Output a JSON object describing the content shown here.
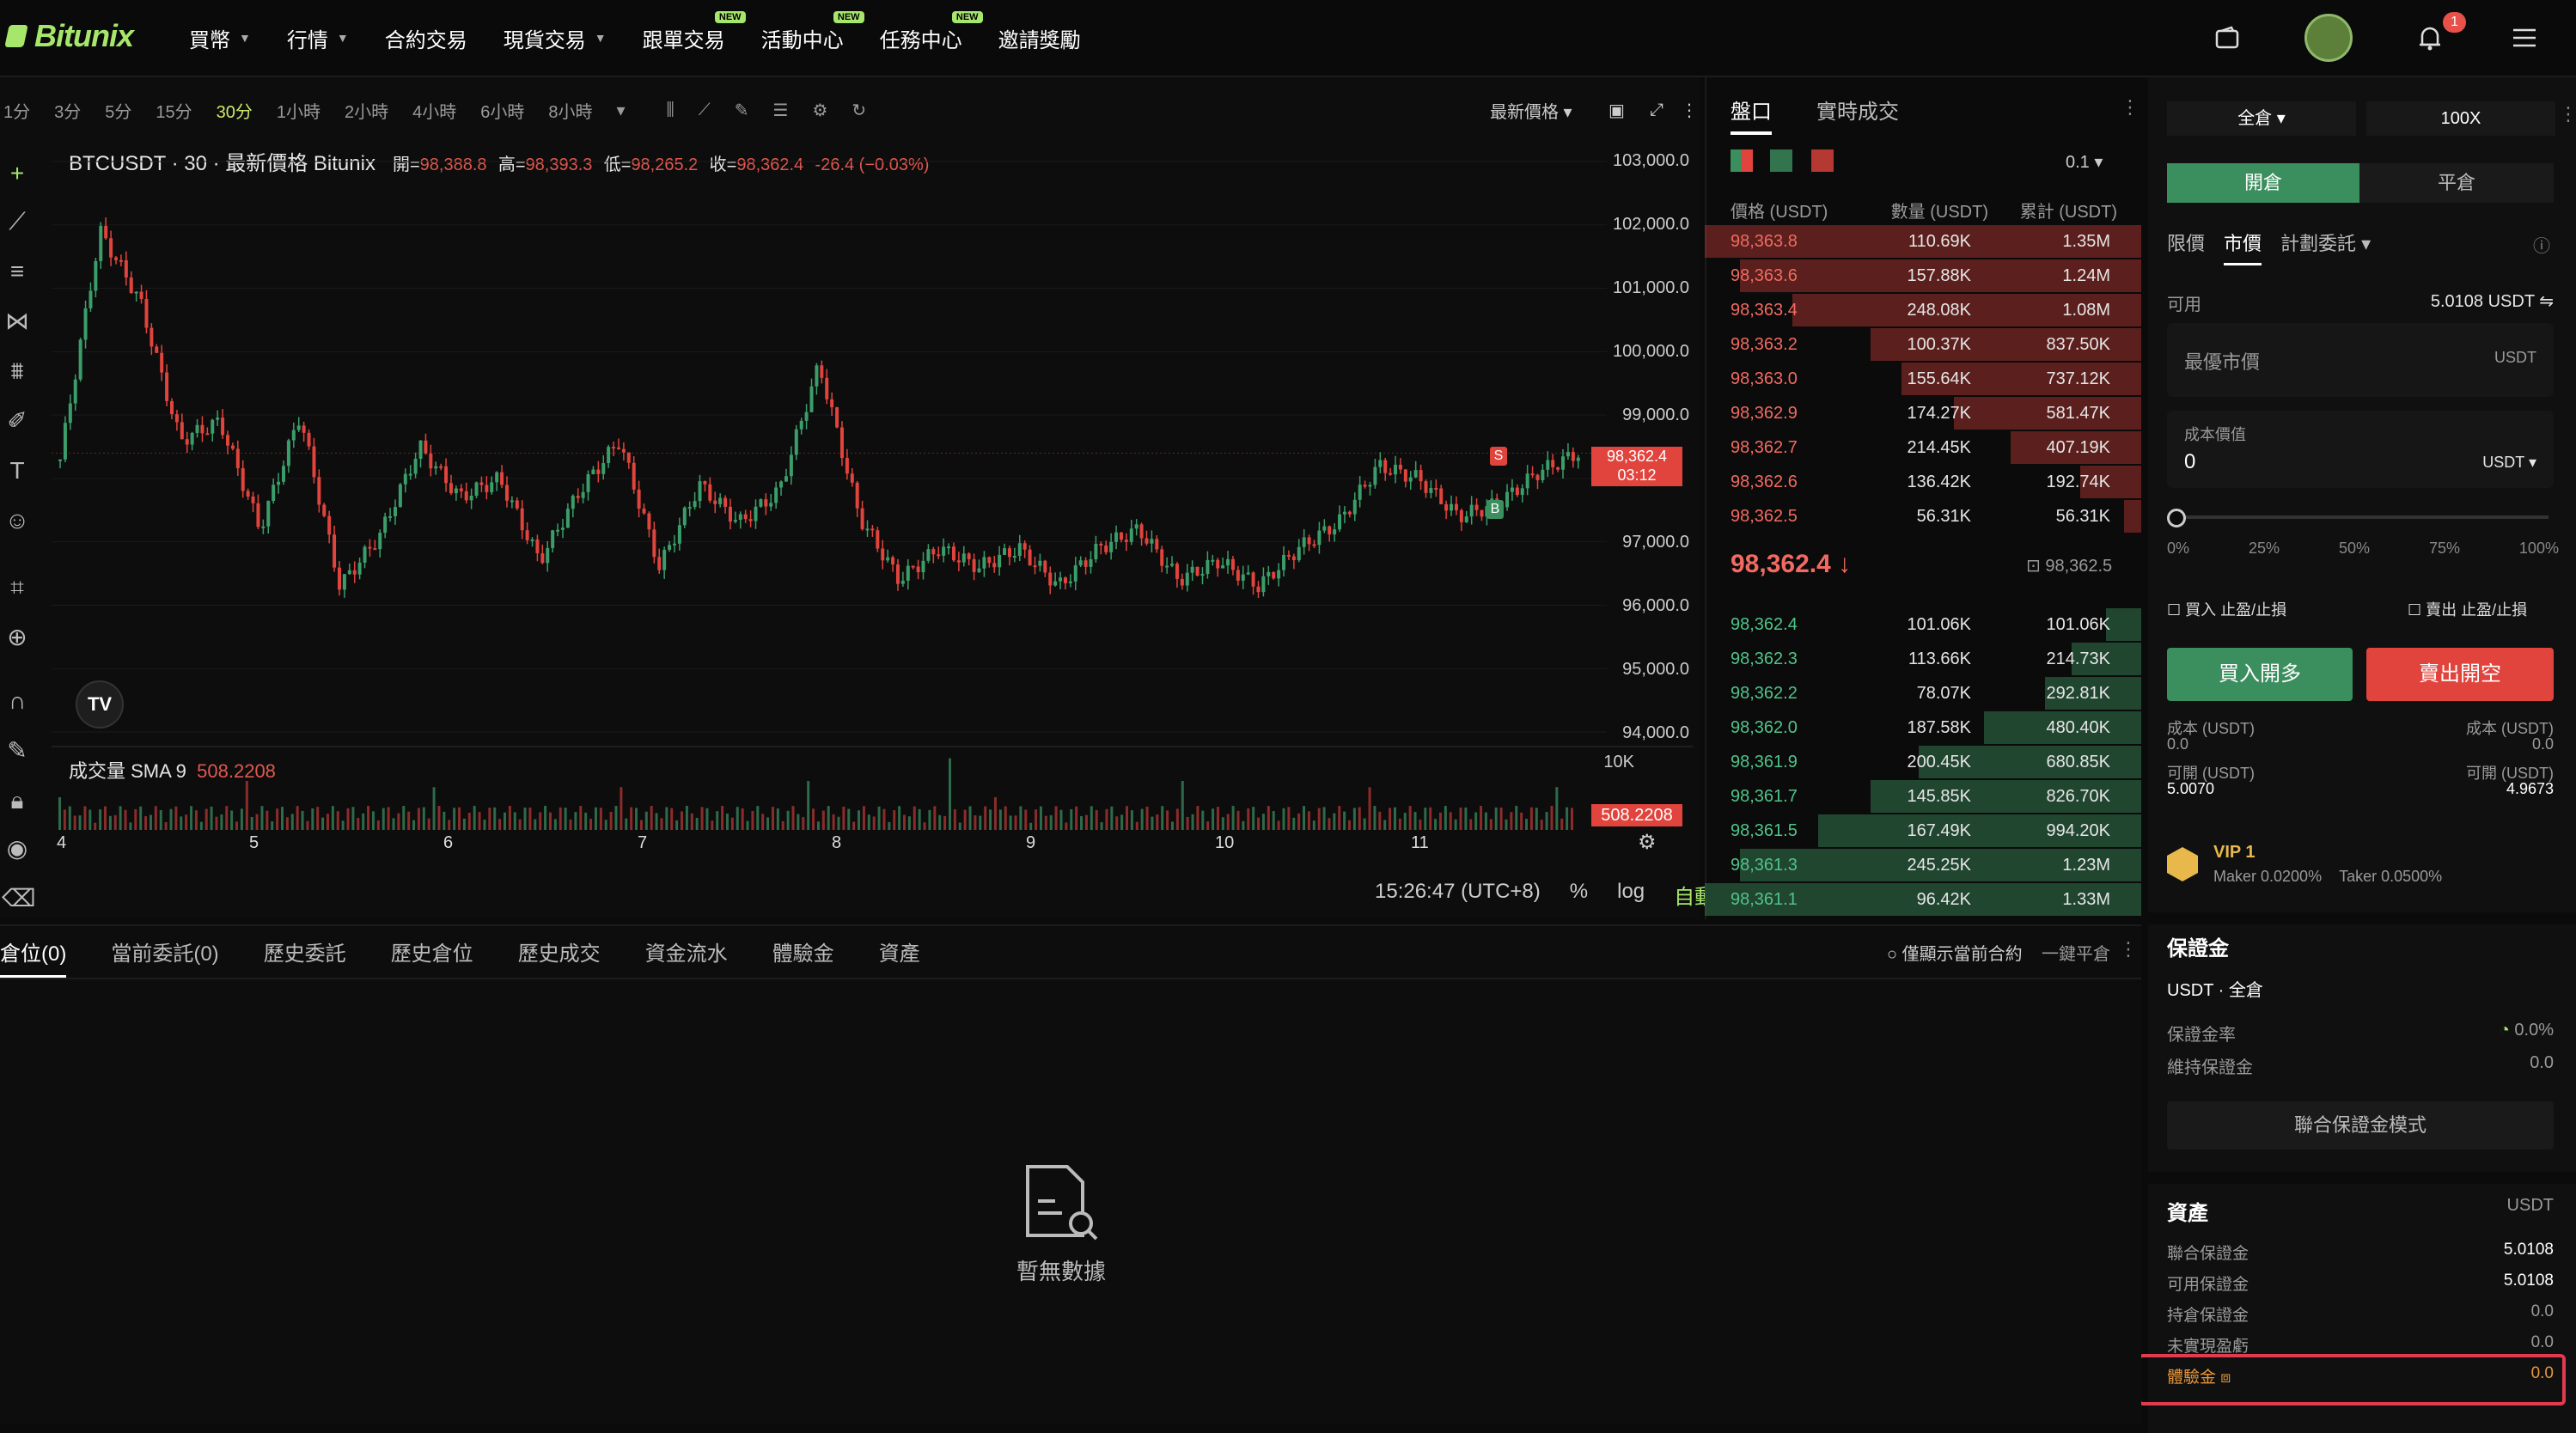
{
  "nav": {
    "brand": "Bitunix",
    "items": [
      {
        "label": "買幣",
        "caret": true,
        "new": false
      },
      {
        "label": "行情",
        "caret": true,
        "new": false
      },
      {
        "label": "合約交易",
        "caret": false,
        "new": false
      },
      {
        "label": "現貨交易",
        "caret": true,
        "new": false
      },
      {
        "label": "跟單交易",
        "caret": false,
        "new": true
      },
      {
        "label": "活動中心",
        "caret": false,
        "new": true
      },
      {
        "label": "任務中心",
        "caret": false,
        "new": true
      },
      {
        "label": "邀請獎勵",
        "caret": false,
        "new": false
      }
    ],
    "new_badge": "NEW",
    "notification_count": "1"
  },
  "chart_toolbar": {
    "timeframes": [
      "1分",
      "3分",
      "5分",
      "15分",
      "30分",
      "1小時",
      "2小時",
      "4小時",
      "6小時",
      "8小時"
    ],
    "active_timeframe": "30分",
    "price_type": "最新價格"
  },
  "chart": {
    "symbol_line": "BTCUSDT · 30 · 最新價格 Bitunix",
    "open_label": "開=",
    "open": "98,388.8",
    "high_label": "高=",
    "high": "98,393.3",
    "low_label": "低=",
    "low": "98,265.2",
    "close_label": "收=",
    "close": "98,362.4",
    "change": "-26.4 (−0.03%)",
    "y_ticks": [
      "103,000.0",
      "102,000.0",
      "101,000.0",
      "100,000.0",
      "99,000.0",
      "97,000.0",
      "96,000.0",
      "95,000.0",
      "94,000.0"
    ],
    "current_price": "98,362.4",
    "countdown": "03:12",
    "volume_label": "成交量 SMA 9",
    "volume_value": "508.2208",
    "volume_axis": "10K",
    "x_ticks": [
      "4",
      "5",
      "6",
      "7",
      "8",
      "9",
      "10",
      "11"
    ],
    "time": "15:26:47 (UTC+8)",
    "scale_percent": "%",
    "scale_log": "log",
    "scale_auto": "自動",
    "marker_sell": "S",
    "marker_buy": "B",
    "tv_logo": "TV"
  },
  "chart_data": {
    "type": "line",
    "x_ticks": [
      "4",
      "5",
      "6",
      "7",
      "8",
      "9",
      "10",
      "11"
    ],
    "ylim": [
      94000,
      103000
    ],
    "y_ticks": [
      94000,
      95000,
      96000,
      97000,
      98000,
      99000,
      100000,
      101000,
      102000,
      103000
    ],
    "x": [
      4.0,
      4.2,
      4.4,
      4.6,
      4.8,
      5.0,
      5.2,
      5.4,
      5.6,
      5.8,
      6.0,
      6.2,
      6.4,
      6.6,
      6.8,
      7.0,
      7.2,
      7.4,
      7.6,
      7.8,
      8.0,
      8.2,
      8.4,
      8.6,
      8.8,
      9.0,
      9.2,
      9.4,
      9.6,
      9.8,
      10.0,
      10.2,
      10.4,
      10.6,
      10.8,
      11.0,
      11.2,
      11.4,
      11.6
    ],
    "series": [
      {
        "values": [
          98300,
          101900,
          100800,
          98600,
          98900,
          97200,
          99000,
          96300,
          97100,
          98500,
          97700,
          98000,
          96700,
          97800,
          98600,
          96600,
          97900,
          97300,
          97800,
          99800,
          97400,
          96400,
          96900,
          96600,
          96900,
          96300,
          96900,
          97200,
          96400,
          96700,
          96300,
          96900,
          97300,
          98200,
          98000,
          97400,
          97600,
          98100,
          98400
        ]
      }
    ],
    "volume_value": "508.2208"
  },
  "orderbook": {
    "tabs": [
      "盤口",
      "實時成交"
    ],
    "precision": "0.1",
    "headers": [
      "價格 (USDT)",
      "數量 (USDT)",
      "累計 (USDT)"
    ],
    "asks": [
      {
        "price": "98,363.8",
        "qty": "110.69K",
        "total": "1.35M",
        "depth": 1.0
      },
      {
        "price": "98,363.6",
        "qty": "157.88K",
        "total": "1.24M",
        "depth": 0.92
      },
      {
        "price": "98,363.4",
        "qty": "248.08K",
        "total": "1.08M",
        "depth": 0.8
      },
      {
        "price": "98,363.2",
        "qty": "100.37K",
        "total": "837.50K",
        "depth": 0.62
      },
      {
        "price": "98,363.0",
        "qty": "155.64K",
        "total": "737.12K",
        "depth": 0.55
      },
      {
        "price": "98,362.9",
        "qty": "174.27K",
        "total": "581.47K",
        "depth": 0.43
      },
      {
        "price": "98,362.7",
        "qty": "214.45K",
        "total": "407.19K",
        "depth": 0.3
      },
      {
        "price": "98,362.6",
        "qty": "136.42K",
        "total": "192.74K",
        "depth": 0.14
      },
      {
        "price": "98,362.5",
        "qty": "56.31K",
        "total": "56.31K",
        "depth": 0.04
      }
    ],
    "last_price": "98,362.4 ↓",
    "mark_price": "98,362.5",
    "bids": [
      {
        "price": "98,362.4",
        "qty": "101.06K",
        "total": "101.06K",
        "depth": 0.08
      },
      {
        "price": "98,362.3",
        "qty": "113.66K",
        "total": "214.73K",
        "depth": 0.16
      },
      {
        "price": "98,362.2",
        "qty": "78.07K",
        "total": "292.81K",
        "depth": 0.22
      },
      {
        "price": "98,362.0",
        "qty": "187.58K",
        "total": "480.40K",
        "depth": 0.36
      },
      {
        "price": "98,361.9",
        "qty": "200.45K",
        "total": "680.85K",
        "depth": 0.51
      },
      {
        "price": "98,361.7",
        "qty": "145.85K",
        "total": "826.70K",
        "depth": 0.62
      },
      {
        "price": "98,361.5",
        "qty": "167.49K",
        "total": "994.20K",
        "depth": 0.74
      },
      {
        "price": "98,361.3",
        "qty": "245.25K",
        "total": "1.23M",
        "depth": 0.92
      },
      {
        "price": "98,361.1",
        "qty": "96.42K",
        "total": "1.33M",
        "depth": 1.0
      }
    ]
  },
  "order_form": {
    "margin_mode": "全倉",
    "leverage": "100X",
    "open_tab": "開倉",
    "close_tab": "平倉",
    "order_types": [
      "限價",
      "市價",
      "計劃委託"
    ],
    "available_label": "可用",
    "available_value": "5.0108 USDT ⇋",
    "price_placeholder": "最優市價",
    "price_unit": "USDT",
    "cost_label": "成本價值",
    "cost_value": "0",
    "cost_unit": "USDT",
    "slider_marks": [
      "0%",
      "25%",
      "50%",
      "75%",
      "100%"
    ],
    "slider_level": 0,
    "tp_sl_buy": "買入 止盈/止損",
    "tp_sl_sell": "賣出 止盈/止損",
    "buy_button": "買入開多",
    "sell_button": "賣出開空",
    "cost_buy_label": "成本 (USDT)",
    "cost_buy": "0.0",
    "cost_sell_label": "成本 (USDT)",
    "cost_sell": "0.0",
    "open_buy_label": "可開 (USDT)",
    "open_buy": "5.0070",
    "open_sell_label": "可開 (USDT)",
    "open_sell": "4.9673",
    "vip_label": "VIP 1",
    "maker": "Maker 0.0200%",
    "taker": "Taker 0.0500%",
    "margin_title": "保證金",
    "margin_mode_line": "USDT · 全倉",
    "margin_rate_label": "保證金率",
    "margin_rate": "0.0%",
    "maint_margin_label": "維持保證金",
    "maint_margin": "0.0",
    "joint_margin_button": "聯合保證金模式",
    "assets_title": "資產",
    "assets_unit": "USDT",
    "assets": [
      {
        "label": "聯合保證金",
        "value": "5.0108"
      },
      {
        "label": "可用保證金",
        "value": "5.0108"
      },
      {
        "label": "持倉保證金",
        "value": "0.0"
      },
      {
        "label": "未實現盈虧",
        "value": "0.0"
      }
    ],
    "trial_fund_label": "體驗金",
    "trial_fund_value": "0.0"
  },
  "bottom": {
    "tabs": [
      "倉位(0)",
      "當前委託(0)",
      "歷史委託",
      "歷史倉位",
      "歷史成交",
      "資金流水",
      "體驗金",
      "資產"
    ],
    "show_current": "僅顯示當前合約",
    "close_all": "一鍵平倉",
    "empty": "暫無數據"
  },
  "colors": {
    "accent": "#a6e76b",
    "up": "#3b8e5e",
    "down": "#e0443d",
    "highlight_box": "#e23a4f"
  }
}
